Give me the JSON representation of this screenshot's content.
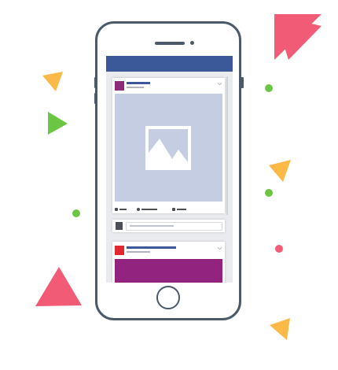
{
  "colors": {
    "phone_outline": "#4a5a6a",
    "topbar": "#3b5998",
    "screen_bg": "#e9ebee",
    "image_placeholder": "#c5cde3",
    "post1_avatar": "#8e2a7a",
    "post2_avatar": "#e0282e",
    "post2_cover": "#92237e",
    "name_line": "#3b5998",
    "meta_line": "#b0b5bd",
    "confetti_pink": "#f15b75",
    "confetti_orange": "#fbb948",
    "confetti_green": "#6cc644"
  },
  "icons": {
    "like": "thumbs-up-icon",
    "comment": "comment-icon",
    "share": "share-icon",
    "image": "image-placeholder-icon",
    "home_button": "home-button",
    "more": "chevron-down-icon"
  },
  "feed": {
    "posts": [
      {
        "has_image": true,
        "actions": [
          "like",
          "comment",
          "share"
        ]
      },
      {
        "has_cover": true
      }
    ],
    "comment_box": {
      "placeholder": ""
    }
  }
}
